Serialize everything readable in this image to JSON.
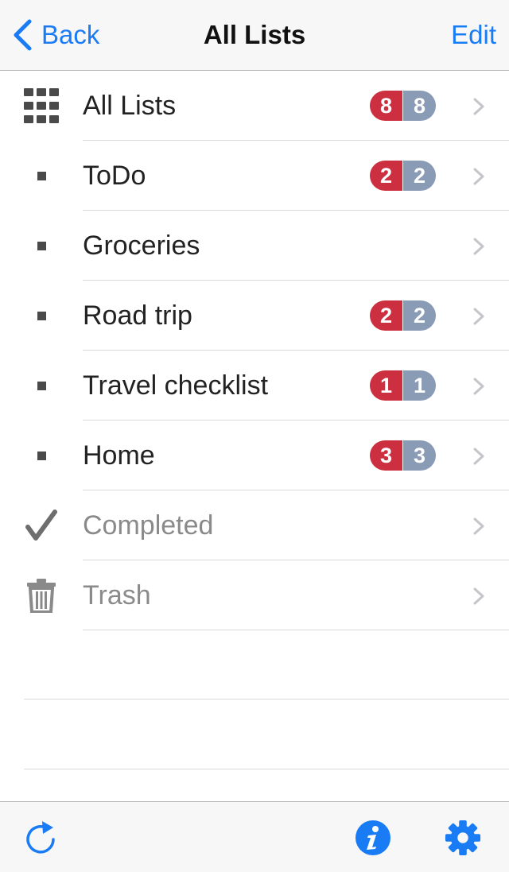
{
  "navbar": {
    "back_label": "Back",
    "title": "All Lists",
    "edit_label": "Edit"
  },
  "lists": [
    {
      "label": "All Lists",
      "icon": "grid-icon",
      "badge_red": "8",
      "badge_gray": "8"
    },
    {
      "label": "ToDo",
      "icon": "bullet-icon",
      "badge_red": "2",
      "badge_gray": "2"
    },
    {
      "label": "Groceries",
      "icon": "bullet-icon",
      "badge_red": null,
      "badge_gray": null
    },
    {
      "label": "Road trip",
      "icon": "bullet-icon",
      "badge_red": "2",
      "badge_gray": "2"
    },
    {
      "label": "Travel checklist",
      "icon": "bullet-icon",
      "badge_red": "1",
      "badge_gray": "1"
    },
    {
      "label": "Home",
      "icon": "bullet-icon",
      "badge_red": "3",
      "badge_gray": "3"
    },
    {
      "label": "Completed",
      "icon": "checkmark-icon",
      "badge_red": null,
      "badge_gray": null
    },
    {
      "label": "Trash",
      "icon": "trash-icon",
      "badge_red": null,
      "badge_gray": null
    }
  ],
  "toolbar": {
    "icons": [
      "refresh-icon",
      "info-icon",
      "gear-icon"
    ]
  },
  "colors": {
    "accent": "#1a7cf5",
    "badge_red": "#cc3040",
    "badge_gray": "#8a9bb6"
  }
}
